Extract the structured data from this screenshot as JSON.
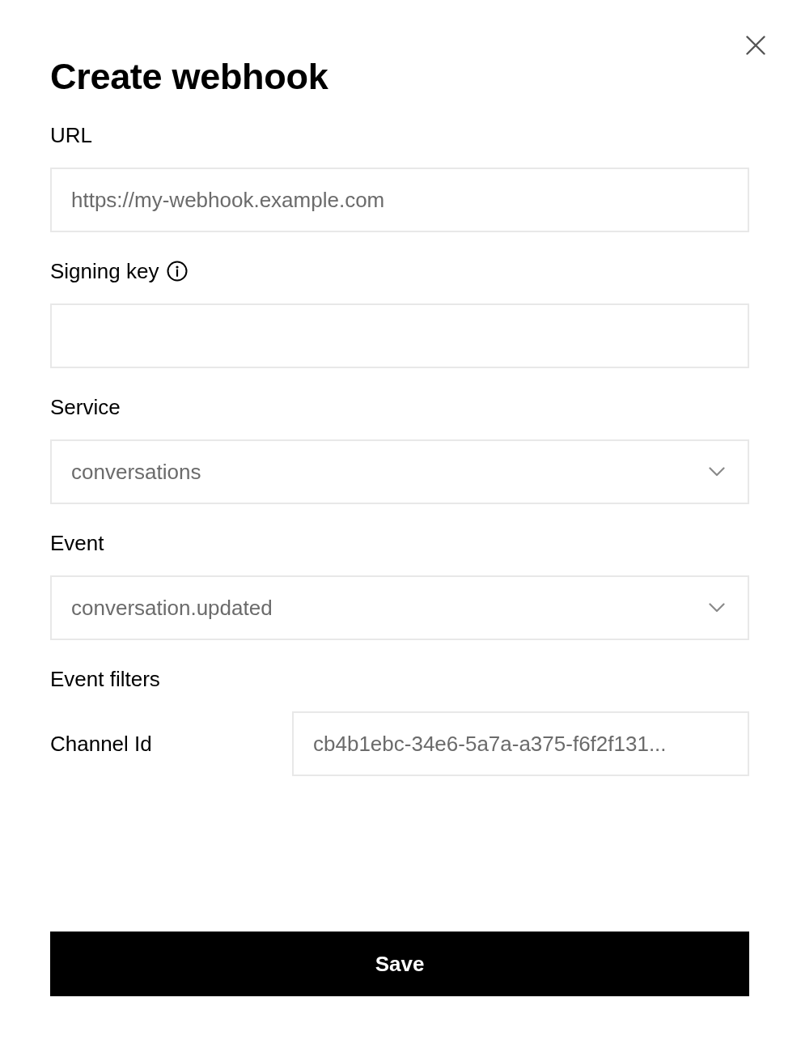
{
  "title": "Create webhook",
  "fields": [
    {
      "kind": "text",
      "label": "URL",
      "placeholder": "https://my-webhook.example.com",
      "info": false
    },
    {
      "kind": "text",
      "label": "Signing key",
      "info": true
    },
    {
      "kind": "select",
      "label": "Service",
      "value": "conversations",
      "info": false
    },
    {
      "kind": "select",
      "label": "Event",
      "value": "conversation.updated",
      "info": false
    }
  ],
  "event_filters": {
    "title": "Event filters",
    "filters": [
      {
        "label": "Channel Id",
        "value": "cb4b1ebc-34e6-5a7a-a375-f6f2f131..."
      }
    ]
  },
  "buttons": [
    {
      "label": "Save"
    }
  ]
}
